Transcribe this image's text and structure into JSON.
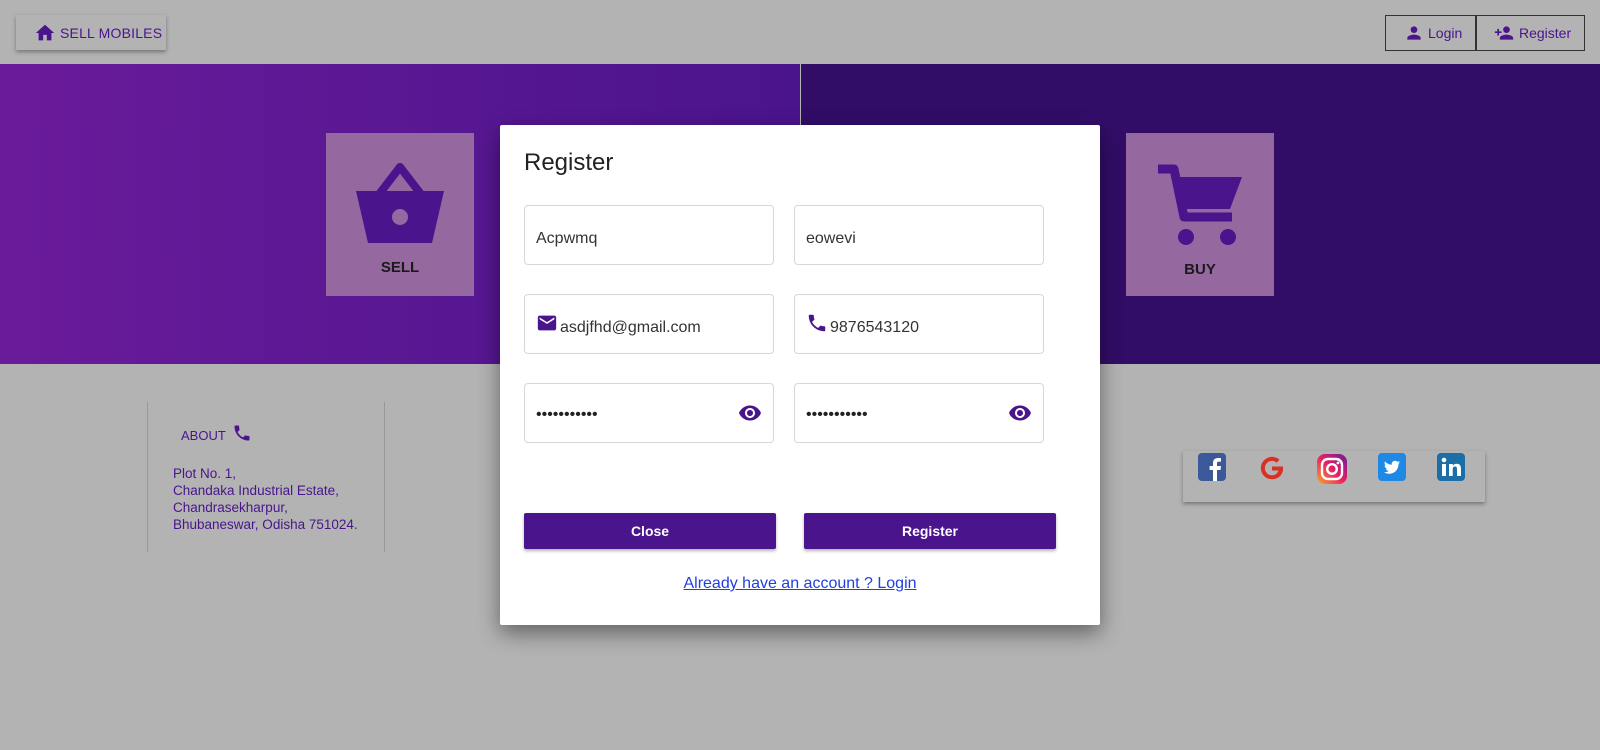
{
  "topbar": {
    "home_label": "SELL MOBILES",
    "login_label": "Login",
    "register_label": "Register"
  },
  "hero": {
    "sell_label": "SELL",
    "buy_label": "BUY"
  },
  "about": {
    "title": "ABOUT",
    "address_lines": [
      "Plot No. 1,",
      "Chandaka Industrial Estate,",
      "Chandrasekharpur,",
      "Bhubaneswar, Odisha 751024."
    ]
  },
  "social": {
    "items": [
      "facebook-icon",
      "google-icon",
      "instagram-icon",
      "twitter-icon",
      "linkedin-icon"
    ]
  },
  "modal": {
    "title": "Register",
    "first_name": "Acpwmq",
    "last_name": "eowevi",
    "email": "asdjfhd@gmail.com",
    "phone": "9876543120",
    "password_mask": "•••••••••••",
    "confirm_password_mask": "•••••••••••",
    "close_label": "Close",
    "register_label": "Register",
    "login_link": "Already have an account ? Login"
  },
  "colors": {
    "primary": "#4a148c",
    "hero_left": "#6a1b9a",
    "hero_right": "#320d68",
    "tile": "#9569a0",
    "backdrop": "#b3b3b3",
    "link": "#2040e0"
  }
}
